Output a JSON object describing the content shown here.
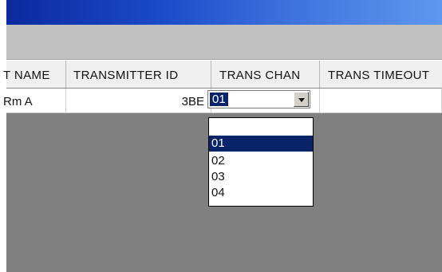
{
  "window": {
    "title": ""
  },
  "table": {
    "headers": {
      "name": "T NAME",
      "transmitter_id": "TRANSMITTER ID",
      "trans_chan": "TRANS CHAN",
      "trans_timeout": "TRANS TIMEOUT"
    },
    "row": {
      "name": "Rm A",
      "transmitter_id": "3BE",
      "trans_chan": "01",
      "trans_timeout": ""
    }
  },
  "combo": {
    "selected_value": "01",
    "icon": "chevron-down-icon"
  },
  "dropdown": {
    "options": [
      "",
      "01",
      "02",
      "03",
      "04"
    ],
    "highlighted": "01"
  },
  "colors": {
    "title_gradient_start": "#0a2a9e",
    "title_gradient_end": "#5e97f0",
    "toolbar": "#c0c0c0",
    "grid_background": "#808080",
    "selection": "#0a246a"
  }
}
